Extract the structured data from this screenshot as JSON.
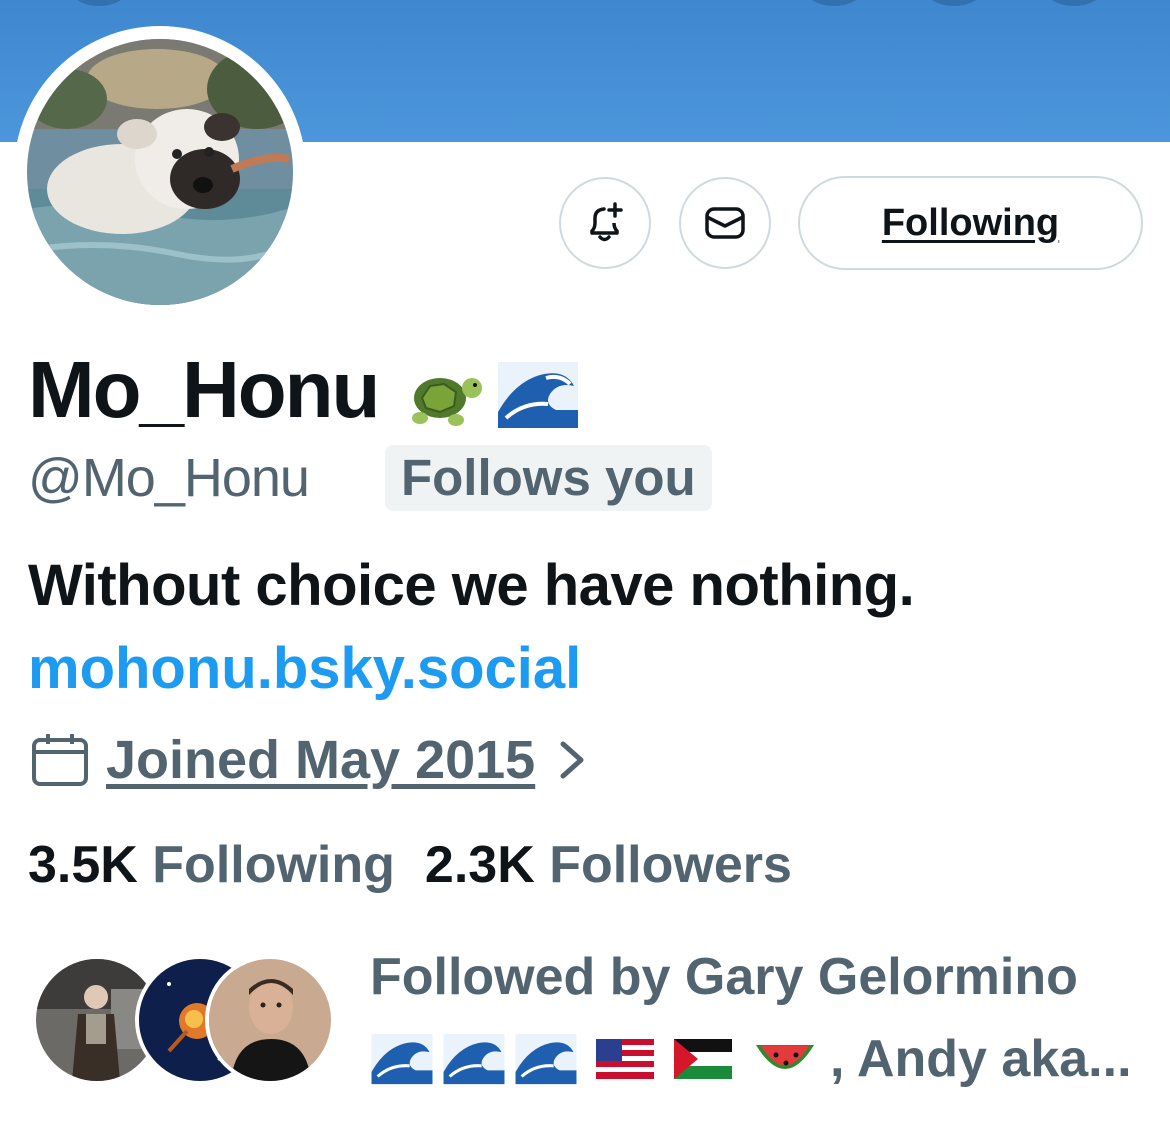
{
  "profile": {
    "display_name": "Mo_Honu",
    "name_emojis": [
      "turtle-emoji",
      "wave-emoji"
    ],
    "handle": "@Mo_Honu",
    "follows_you_label": "Follows you",
    "bio": "Without choice we have nothing.",
    "link": "mohonu.bsky.social",
    "joined": "Joined May 2015"
  },
  "actions": {
    "notify_icon": "bell-plus-icon",
    "message_icon": "envelope-icon",
    "following_label": "Following"
  },
  "stats": {
    "following_count": "3.5K",
    "following_label": "Following",
    "followers_count": "2.3K",
    "followers_label": "Followers"
  },
  "followed_by": {
    "line1": "Followed by Gary Gelormino",
    "line2_emojis": [
      "wave-emoji",
      "wave-emoji",
      "wave-emoji",
      "us-flag-emoji",
      "palestine-flag-emoji",
      "watermelon-emoji"
    ],
    "line2_tail": ", Andy aka..."
  },
  "colors": {
    "banner": "#4a93da",
    "link": "#1d9bf0",
    "secondary_text": "#536471",
    "primary_text": "#0f1419",
    "border": "#cfd9de"
  }
}
